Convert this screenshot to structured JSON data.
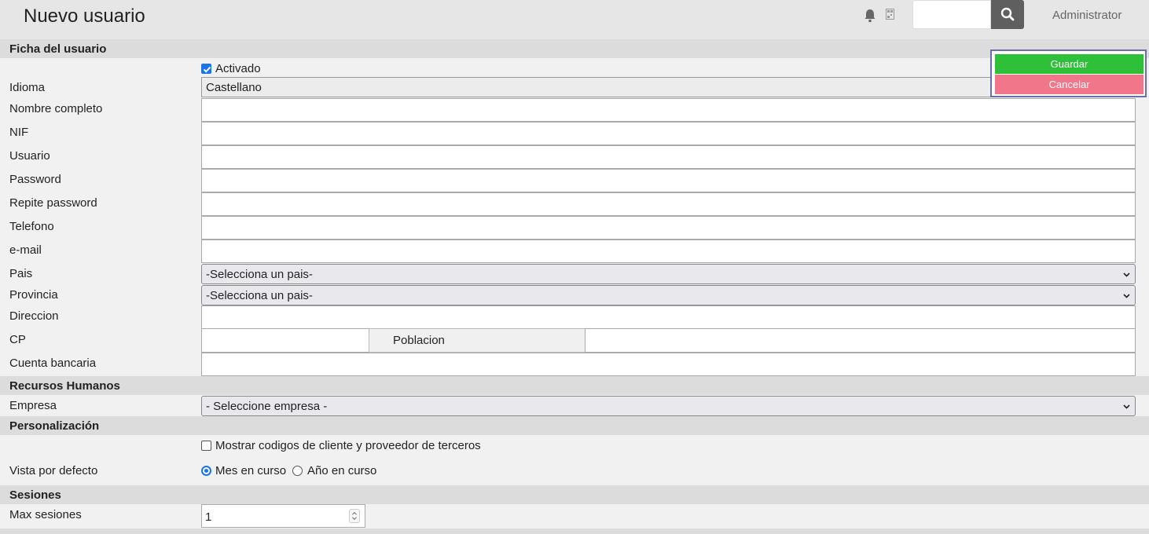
{
  "header": {
    "title": "Nuevo usuario",
    "search_placeholder": "",
    "user": "Administrator",
    "icons": [
      "bell-icon",
      "qr-icon",
      "search-icon"
    ]
  },
  "actions": {
    "save": "Guardar",
    "cancel": "Cancelar",
    "save_color": "#2fc03a",
    "cancel_color": "#f2768a"
  },
  "ficha": {
    "section_title": "Ficha del usuario",
    "activado_label": "Activado",
    "activado_checked": true,
    "idioma_label": "Idioma",
    "idioma_value": "Castellano",
    "nombre_label": "Nombre completo",
    "nif_label": "NIF",
    "usuario_label": "Usuario",
    "password_label": "Password",
    "repite_label": "Repite password",
    "telefono_label": "Telefono",
    "email_label": "e-mail",
    "pais_label": "Pais",
    "pais_value": "-Selecciona un pais-",
    "provincia_label": "Provincia",
    "provincia_value": "-Selecciona un pais-",
    "direccion_label": "Direccion",
    "cp_label": "CP",
    "poblacion_label": "Poblacion",
    "cuenta_label": "Cuenta bancaria"
  },
  "rrhh": {
    "section_title": "Recursos Humanos",
    "empresa_label": "Empresa",
    "empresa_value": "- Seleccione empresa -"
  },
  "personalizacion": {
    "section_title": "Personalización",
    "mostrar_label": "Mostrar codigos de cliente y proveedor de terceros",
    "mostrar_checked": false,
    "vista_label": "Vista por defecto",
    "opt_mes": "Mes en curso",
    "opt_anio": "Año en curso",
    "selected": "Mes en curso"
  },
  "sesiones": {
    "section_title": "Sesiones",
    "max_label": "Max sesiones",
    "max_value": "1"
  }
}
